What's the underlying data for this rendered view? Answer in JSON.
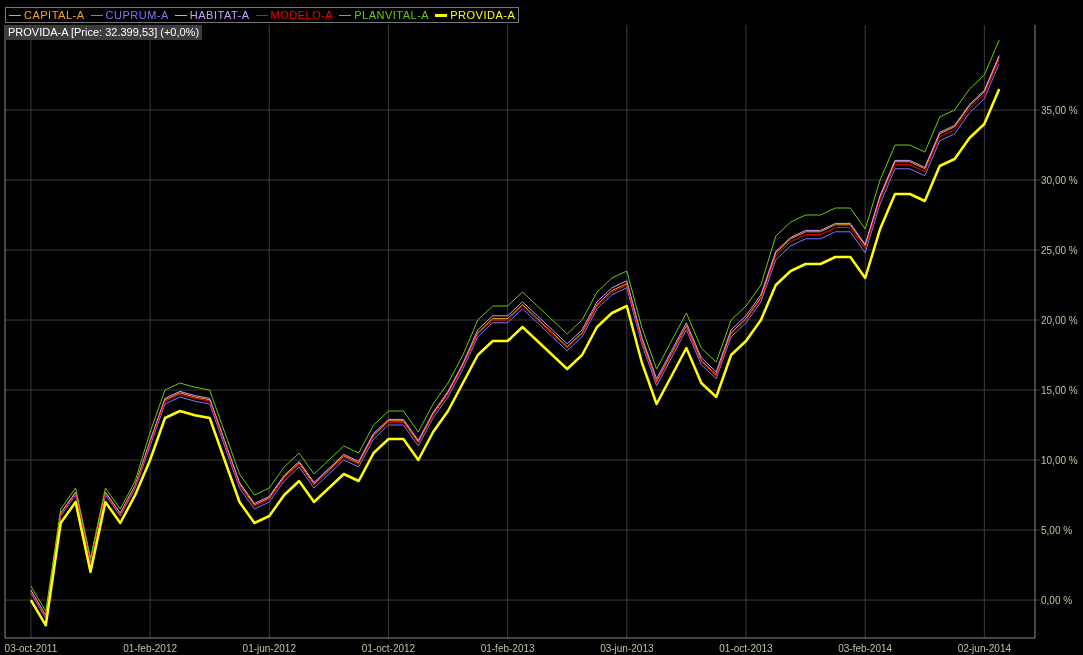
{
  "chart_data": {
    "type": "line",
    "grid": true,
    "categories": [
      "03-oct-2011",
      null,
      null,
      null,
      null,
      null,
      null,
      null,
      "01-feb-2012",
      null,
      null,
      null,
      null,
      null,
      null,
      null,
      "01-jun-2012",
      null,
      null,
      null,
      null,
      null,
      null,
      null,
      "01-oct-2012",
      null,
      null,
      null,
      null,
      null,
      null,
      null,
      "01-feb-2013",
      null,
      null,
      null,
      null,
      null,
      null,
      null,
      "03-jun-2013",
      null,
      null,
      null,
      null,
      null,
      null,
      null,
      "01-oct-2013",
      null,
      null,
      null,
      null,
      null,
      null,
      null,
      "03-feb-2014",
      null,
      null,
      null,
      null,
      null,
      null,
      null,
      "02-jun-2014",
      null
    ],
    "series": [
      {
        "name": "CAPITAL-A",
        "color": "#ffa500",
        "values": [
          0.7,
          -1.1,
          6.2,
          7.7,
          2.7,
          7.7,
          6.2,
          8.2,
          11.3,
          14.3,
          14.8,
          14.5,
          14.3,
          11.3,
          8.3,
          6.8,
          7.3,
          8.8,
          9.8,
          8.3,
          9.3,
          10.3,
          9.8,
          11.8,
          12.8,
          12.8,
          11.3,
          13.3,
          14.8,
          16.8,
          19.1,
          20.1,
          20.1,
          21.1,
          20.1,
          19.1,
          18.1,
          19.1,
          21.1,
          22.1,
          22.6,
          18.6,
          15.6,
          17.6,
          19.6,
          17.1,
          16.1,
          19.1,
          20.1,
          21.6,
          24.8,
          25.8,
          26.3,
          26.3,
          26.8,
          26.8,
          25.3,
          28.8,
          31.3,
          31.3,
          30.8,
          33.3,
          33.8,
          35.3,
          36.3,
          38.8
        ]
      },
      {
        "name": "CUPRUM-A",
        "color": "#7878ff",
        "values": [
          0.5,
          -1.3,
          6,
          7.5,
          2.5,
          7.5,
          6,
          8,
          11,
          14,
          14.5,
          14.2,
          14,
          11,
          8,
          6.5,
          7,
          8.5,
          9.5,
          8,
          9,
          10,
          9.5,
          11.5,
          12.5,
          12.5,
          11,
          13,
          14.5,
          16.5,
          18.8,
          19.8,
          19.8,
          20.8,
          19.8,
          18.8,
          17.8,
          18.8,
          20.8,
          21.8,
          22.3,
          18.3,
          15.3,
          17.3,
          19.3,
          16.8,
          15.8,
          18.8,
          19.8,
          21.3,
          24.3,
          25.3,
          25.8,
          25.8,
          26.3,
          26.3,
          24.8,
          28.3,
          30.8,
          30.8,
          30.3,
          32.8,
          33.3,
          34.8,
          35.8,
          38.3
        ]
      },
      {
        "name": "HABITAT-A",
        "color": "#c8a0ff",
        "values": [
          0.7,
          -1.1,
          6.2,
          7.7,
          2.7,
          7.7,
          6.2,
          8.2,
          11.4,
          14.4,
          14.9,
          14.6,
          14.4,
          11.4,
          8.4,
          6.9,
          7.4,
          8.9,
          9.9,
          8.4,
          9.4,
          10.4,
          9.9,
          11.9,
          12.9,
          12.9,
          11.4,
          13.4,
          14.9,
          16.9,
          19.3,
          20.3,
          20.3,
          21.3,
          20.3,
          19.3,
          18.3,
          19.3,
          21.3,
          22.3,
          22.8,
          18.8,
          15.8,
          17.8,
          19.8,
          17.3,
          16.3,
          19.3,
          20.3,
          21.8,
          24.9,
          25.9,
          26.4,
          26.4,
          26.9,
          26.9,
          25.4,
          28.9,
          31.4,
          31.4,
          30.9,
          33.4,
          33.9,
          35.4,
          36.4,
          38.9
        ]
      },
      {
        "name": "MODELO-A",
        "color": "#ff0000",
        "values": [
          0.6,
          -1.2,
          6.1,
          7.6,
          2.6,
          7.6,
          6.1,
          8.1,
          11.2,
          14.2,
          14.7,
          14.4,
          14.2,
          11.2,
          8.2,
          6.7,
          7.2,
          8.7,
          9.7,
          8.2,
          9.2,
          10.2,
          9.7,
          11.7,
          12.7,
          12.7,
          11.2,
          13.2,
          14.7,
          16.7,
          19,
          20,
          20,
          21,
          20,
          19,
          18,
          19,
          21,
          22,
          22.5,
          18.5,
          15.5,
          17.5,
          19.5,
          17,
          16,
          19,
          20,
          21.5,
          24.6,
          25.6,
          26.1,
          26.1,
          26.6,
          26.6,
          25.1,
          28.6,
          31.1,
          31.1,
          30.6,
          33.1,
          33.6,
          35.1,
          36.1,
          38.6
        ]
      },
      {
        "name": "PLANVITAL-A",
        "color": "#66cc00",
        "values": [
          1,
          -0.8,
          6.5,
          8,
          3,
          8,
          6.5,
          8.5,
          12,
          15,
          15.5,
          15.2,
          15,
          12,
          9,
          7.5,
          8,
          9.5,
          10.5,
          9,
          10,
          11,
          10.5,
          12.5,
          13.5,
          13.5,
          12,
          14,
          15.5,
          17.5,
          20,
          21,
          21,
          22,
          21,
          20,
          19,
          20,
          22,
          23,
          23.5,
          19.5,
          16.5,
          18.5,
          20.5,
          18,
          17,
          20,
          21,
          22.5,
          26,
          27,
          27.5,
          27.5,
          28,
          28,
          26.5,
          30,
          32.5,
          32.5,
          32,
          34.5,
          35,
          36.5,
          37.5,
          40
        ]
      },
      {
        "name": "PROVIDA-A",
        "color": "#ffff00",
        "values": [
          0,
          -1.8,
          5.5,
          7,
          2,
          7,
          5.5,
          7.5,
          10,
          13,
          13.5,
          13.2,
          13,
          10,
          7,
          5.5,
          6,
          7.5,
          8.5,
          7,
          8,
          9,
          8.5,
          10.5,
          11.5,
          11.5,
          10,
          12,
          13.5,
          15.5,
          17.5,
          18.5,
          18.5,
          19.5,
          18.5,
          17.5,
          16.5,
          17.5,
          19.5,
          20.5,
          21,
          17,
          14,
          16,
          18,
          15.5,
          14.5,
          17.5,
          18.5,
          20,
          22.5,
          23.5,
          24,
          24,
          24.5,
          24.5,
          23,
          26.5,
          29,
          29,
          28.5,
          31,
          31.5,
          33,
          34,
          36.5
        ]
      }
    ],
    "ylim": [
      -2.71,
      41.07
    ],
    "yticks": [
      {
        "value": 0,
        "label": "0,00 %"
      },
      {
        "value": 5,
        "label": "5,00 %"
      },
      {
        "value": 10,
        "label": "10,00 %"
      },
      {
        "value": 15,
        "label": "15,00 %"
      },
      {
        "value": 20,
        "label": "20,00 %"
      },
      {
        "value": 25,
        "label": "25,00 %"
      },
      {
        "value": 30,
        "label": "30,00 %"
      },
      {
        "value": 35,
        "label": "35,00 %"
      }
    ]
  },
  "price_label": "PROVIDA-A [Price: 32.399,53] (+0,0%)"
}
